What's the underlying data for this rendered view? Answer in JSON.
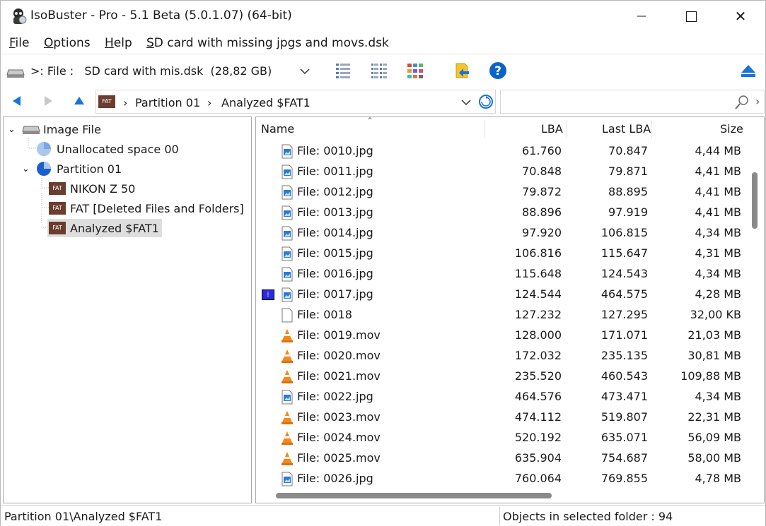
{
  "window": {
    "title": "IsoBuster - Pro - 5.1 Beta (5.0.1.07) (64-bit)",
    "minimize_glyph": "—",
    "maximize_glyph": "☐",
    "close_glyph": "✕"
  },
  "menu": {
    "items": [
      {
        "u": "F",
        "rest": "ile"
      },
      {
        "u": "O",
        "rest": "ptions"
      },
      {
        "u": "H",
        "rest": "elp"
      },
      {
        "u": "S",
        "rest": "D card with missing jpgs and movs.dsk"
      }
    ]
  },
  "toolbar": {
    "drive_label": ">: File :   SD card with mis.dsk  (28,82 GB)"
  },
  "address": {
    "crumbs": [
      "Partition 01",
      "Analyzed $FAT1"
    ],
    "fat_badge": "FAT"
  },
  "tree": {
    "root": "Image File",
    "unallocated": "Unallocated space 00",
    "partition": "Partition 01",
    "children": [
      "NIKON Z 50",
      "FAT [Deleted Files and Folders]",
      "Analyzed $FAT1"
    ],
    "badge": "FAT"
  },
  "columns": {
    "name": "Name",
    "lba": "LBA",
    "last_lba": "Last LBA",
    "size": "Size"
  },
  "files": [
    {
      "name": "File: 0010.jpg",
      "lba": "61.760",
      "last": "70.847",
      "size": "4,44 MB",
      "type": "jpg",
      "marked": false
    },
    {
      "name": "File: 0011.jpg",
      "lba": "70.848",
      "last": "79.871",
      "size": "4,41 MB",
      "type": "jpg",
      "marked": false
    },
    {
      "name": "File: 0012.jpg",
      "lba": "79.872",
      "last": "88.895",
      "size": "4,41 MB",
      "type": "jpg",
      "marked": false
    },
    {
      "name": "File: 0013.jpg",
      "lba": "88.896",
      "last": "97.919",
      "size": "4,41 MB",
      "type": "jpg",
      "marked": false
    },
    {
      "name": "File: 0014.jpg",
      "lba": "97.920",
      "last": "106.815",
      "size": "4,34 MB",
      "type": "jpg",
      "marked": false
    },
    {
      "name": "File: 0015.jpg",
      "lba": "106.816",
      "last": "115.647",
      "size": "4,31 MB",
      "type": "jpg",
      "marked": false
    },
    {
      "name": "File: 0016.jpg",
      "lba": "115.648",
      "last": "124.543",
      "size": "4,34 MB",
      "type": "jpg",
      "marked": false
    },
    {
      "name": "File: 0017.jpg",
      "lba": "124.544",
      "last": "464.575",
      "size": "4,28 MB",
      "type": "jpg",
      "marked": true
    },
    {
      "name": "File: 0018",
      "lba": "127.232",
      "last": "127.295",
      "size": "32,00 KB",
      "type": "blank",
      "marked": false
    },
    {
      "name": "File: 0019.mov",
      "lba": "128.000",
      "last": "171.071",
      "size": "21,03 MB",
      "type": "mov",
      "marked": false
    },
    {
      "name": "File: 0020.mov",
      "lba": "172.032",
      "last": "235.135",
      "size": "30,81 MB",
      "type": "mov",
      "marked": false
    },
    {
      "name": "File: 0021.mov",
      "lba": "235.520",
      "last": "460.543",
      "size": "109,88 MB",
      "type": "mov",
      "marked": false
    },
    {
      "name": "File: 0022.jpg",
      "lba": "464.576",
      "last": "473.471",
      "size": "4,34 MB",
      "type": "jpg",
      "marked": false
    },
    {
      "name": "File: 0023.mov",
      "lba": "474.112",
      "last": "519.807",
      "size": "22,31 MB",
      "type": "mov",
      "marked": false
    },
    {
      "name": "File: 0024.mov",
      "lba": "520.192",
      "last": "635.071",
      "size": "56,09 MB",
      "type": "mov",
      "marked": false
    },
    {
      "name": "File: 0025.mov",
      "lba": "635.904",
      "last": "754.687",
      "size": "58,00 MB",
      "type": "mov",
      "marked": false
    },
    {
      "name": "File: 0026.jpg",
      "lba": "760.064",
      "last": "769.855",
      "size": "4,78 MB",
      "type": "jpg",
      "marked": false
    }
  ],
  "status": {
    "path": "Partition 01\\Analyzed $FAT1",
    "objects": "Objects in selected folder : 94"
  },
  "colors": {
    "accent_blue": "#1a73d9",
    "fat_brown": "#6b3d2e",
    "vlc_orange": "#f08a1c",
    "selection": "#dedede"
  }
}
